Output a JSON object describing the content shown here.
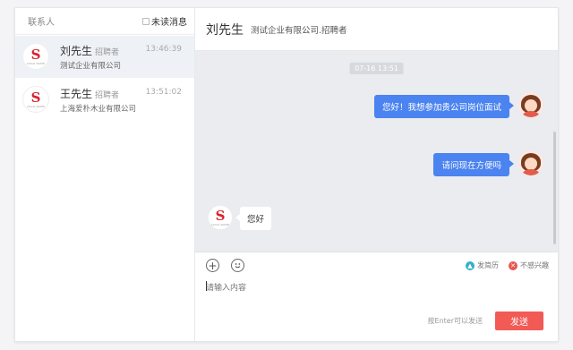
{
  "sidebar": {
    "title": "联系人",
    "unread_label": "未读消息",
    "contacts": [
      {
        "name": "刘先生",
        "role": "招聘者",
        "time": "13:46:39",
        "company": "测试企业有限公司",
        "active": true
      },
      {
        "name": "王先生",
        "role": "招聘者",
        "time": "13:51:02",
        "company": "上海爱朴木业有限公司",
        "active": false
      }
    ]
  },
  "chat": {
    "header": {
      "name": "刘先生",
      "subtitle": "测试企业有限公司.招聘者"
    },
    "timestamp": "07-16 13:51",
    "messages": [
      {
        "direction": "out",
        "text": "您好！我想参加贵公司岗位面试"
      },
      {
        "direction": "out",
        "text": "请问现在方便吗"
      },
      {
        "direction": "in",
        "text": "您好"
      }
    ]
  },
  "composer": {
    "placeholder": "请输入内容",
    "add_icon": "plus-circle-icon",
    "emoji_icon": "smiley-icon",
    "send_resume_label": "发简历",
    "not_interested_label": "不感兴趣",
    "hint": "按Enter可以发送",
    "send_label": "发送"
  },
  "colors": {
    "accent": "#4b83f0",
    "send": "#f15a55",
    "resume_icon": "#35b0c8",
    "not_interested_icon": "#e8574f",
    "logo": "#d8232a"
  }
}
